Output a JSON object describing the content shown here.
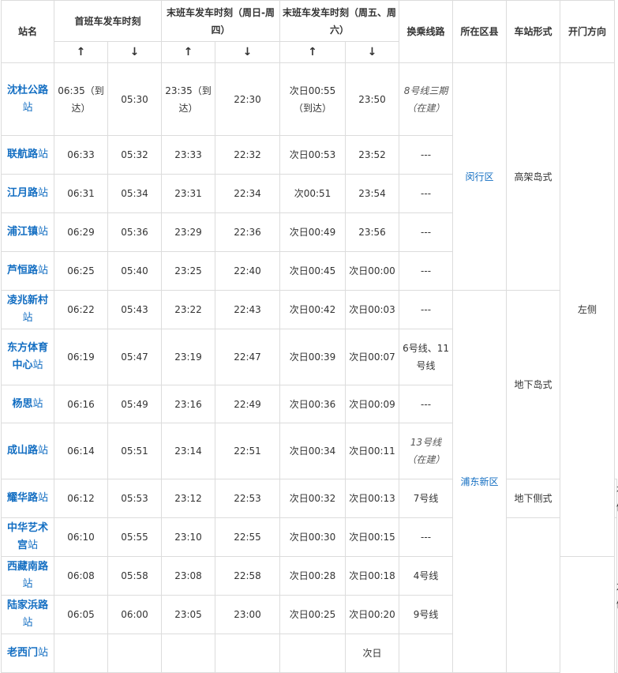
{
  "headers": {
    "station": "站名",
    "first_train": "首班车发车时刻",
    "last_weekday": "末班车发车时刻（周日-周四）",
    "last_weekend": "末班车发车时刻（周五、周六）",
    "transfer": "换乘线路",
    "district": "所在区县",
    "station_form": "车站形式",
    "door_side": "开门方向",
    "up_arrow": "↑",
    "down_arrow": "↓"
  },
  "rows": [
    {
      "name": "沈杜公路",
      "suffix": "站",
      "first_up": "06:35（到达）",
      "first_down": "05:30",
      "wk_up": "23:35（到达）",
      "wk_down": "22:30",
      "we_up": "次日00:55（到达）",
      "we_down": "23:50",
      "transfer": "8号线三期（在建）"
    },
    {
      "name": "联航路",
      "suffix": "站",
      "first_up": "06:33",
      "first_down": "05:32",
      "wk_up": "23:33",
      "wk_down": "22:32",
      "we_up": "次日00:53",
      "we_down": "23:52",
      "transfer": "---"
    },
    {
      "name": "江月路",
      "suffix": "站",
      "first_up": "06:31",
      "first_down": "05:34",
      "wk_up": "23:31",
      "wk_down": "22:34",
      "we_up": "次00:51",
      "we_down": "23:54",
      "transfer": "---"
    },
    {
      "name": "浦江镇",
      "suffix": "站",
      "first_up": "06:29",
      "first_down": "05:36",
      "wk_up": "23:29",
      "wk_down": "22:36",
      "we_up": "次日00:49",
      "we_down": "23:56",
      "transfer": "---"
    },
    {
      "name": "芦恒路",
      "suffix": "站",
      "first_up": "06:25",
      "first_down": "05:40",
      "wk_up": "23:25",
      "wk_down": "22:40",
      "we_up": "次日00:45",
      "we_down": "次日00:00",
      "transfer": "---"
    },
    {
      "name": "凌兆新村",
      "suffix": "站",
      "first_up": "06:22",
      "first_down": "05:43",
      "wk_up": "23:22",
      "wk_down": "22:43",
      "we_up": "次日00:42",
      "we_down": "次日00:03",
      "transfer": "---"
    },
    {
      "name": "东方体育中心",
      "suffix": "站",
      "first_up": "06:19",
      "first_down": "05:47",
      "wk_up": "23:19",
      "wk_down": "22:47",
      "we_up": "次日00:39",
      "we_down": "次日00:07",
      "transfer": "6号线、11号线"
    },
    {
      "name": "杨思",
      "suffix": "站",
      "first_up": "06:16",
      "first_down": "05:49",
      "wk_up": "23:16",
      "wk_down": "22:49",
      "we_up": "次日00:36",
      "we_down": "次日00:09",
      "transfer": "---"
    },
    {
      "name": "成山路",
      "suffix": "站",
      "first_up": "06:14",
      "first_down": "05:51",
      "wk_up": "23:14",
      "wk_down": "22:51",
      "we_up": "次日00:34",
      "we_down": "次日00:11",
      "transfer": "13号线（在建）"
    },
    {
      "name": "耀华路",
      "suffix": "站",
      "first_up": "06:12",
      "first_down": "05:53",
      "wk_up": "23:12",
      "wk_down": "22:53",
      "we_up": "次日00:32",
      "we_down": "次日00:13",
      "transfer": "7号线"
    },
    {
      "name": "中华艺术宫",
      "suffix": "站",
      "first_up": "06:10",
      "first_down": "05:55",
      "wk_up": "23:10",
      "wk_down": "22:55",
      "we_up": "次日00:30",
      "we_down": "次日00:15",
      "transfer": "---"
    },
    {
      "name": "西藏南路",
      "suffix": "站",
      "first_up": "06:08",
      "first_down": "05:58",
      "wk_up": "23:08",
      "wk_down": "22:58",
      "we_up": "次日00:28",
      "we_down": "次日00:18",
      "transfer": "4号线"
    },
    {
      "name": "陆家浜路",
      "suffix": "站",
      "first_up": "06:05",
      "first_down": "06:00",
      "wk_up": "23:05",
      "wk_down": "23:00",
      "we_up": "次日00:25",
      "we_down": "次日00:20",
      "transfer": "9号线"
    },
    {
      "name": "老西门",
      "suffix": "站",
      "first_up": "",
      "first_down": "",
      "wk_up": "",
      "wk_down": "",
      "we_up": "",
      "we_down": "次日",
      "transfer": ""
    }
  ],
  "merged": {
    "district_minhang": "闵行区",
    "district_pudong": "浦东新区",
    "form_elevated": "高架岛式",
    "form_underground_island": "地下岛式",
    "form_underground_side": "地下侧式",
    "door_left_1": "左侧",
    "door_right": "右侧",
    "door_left_2": "左侧"
  }
}
